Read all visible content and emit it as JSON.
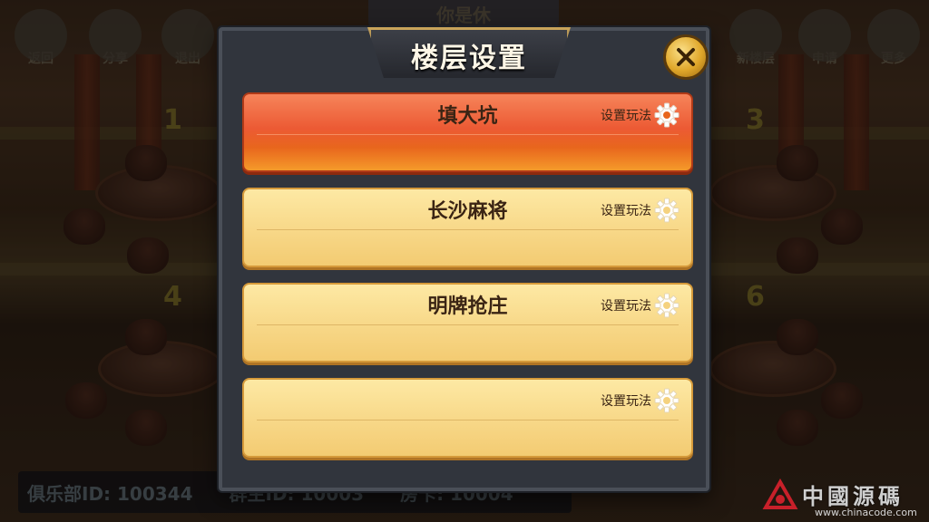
{
  "background": {
    "room_title": "你是休",
    "top_left_buttons": [
      {
        "label": "返回",
        "icon": "back-arrow-icon"
      },
      {
        "label": "分享",
        "icon": "share-icon"
      },
      {
        "label": "退出",
        "icon": "exit-icon"
      }
    ],
    "top_right_buttons": [
      {
        "label": "新楼层",
        "icon": "stairs-icon"
      },
      {
        "label": "申请",
        "icon": "clipboard-icon"
      },
      {
        "label": "更多",
        "icon": "more-dots-icon"
      }
    ],
    "table_numbers": [
      "1",
      "3",
      "4",
      "6"
    ],
    "info_bar": {
      "club_id": "俱乐部ID: 100344",
      "group_id": "群主ID: 10003",
      "room_card": "房卡: 10004"
    }
  },
  "modal": {
    "title": "楼层设置",
    "close_label": "X",
    "rows": [
      {
        "name": "填大坑",
        "setup_label": "设置玩法",
        "active": true
      },
      {
        "name": "长沙麻将",
        "setup_label": "设置玩法",
        "active": false
      },
      {
        "name": "明牌抢庄",
        "setup_label": "设置玩法",
        "active": false
      },
      {
        "name": "",
        "setup_label": "设置玩法",
        "active": false
      }
    ]
  },
  "watermark": {
    "text": "中國源碼",
    "url": "www.chinacode.com"
  },
  "colors": {
    "active_row": "#ec5a34",
    "row": "#f8d98a",
    "modal_bg": "#31353d",
    "close_button": "#e0a72a"
  }
}
